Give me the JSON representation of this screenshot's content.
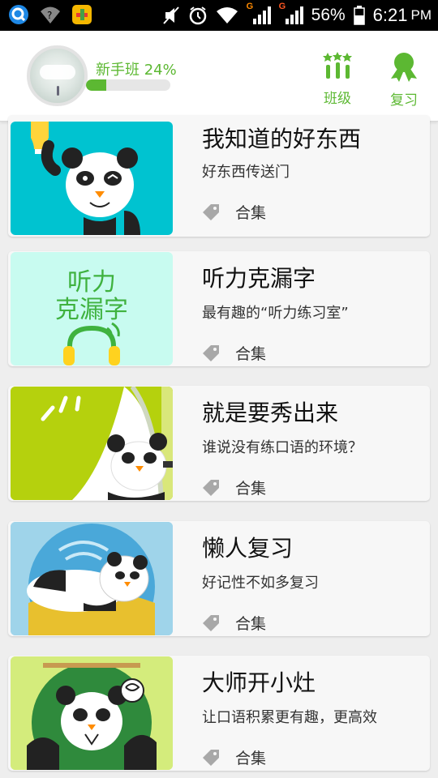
{
  "status_bar": {
    "battery": "56%",
    "time": "6:21",
    "ampm": "PM",
    "net1": "G",
    "net2": "G"
  },
  "header": {
    "level_label": "新手班 24%",
    "progress": 0.24,
    "class_button": "班级",
    "review_button": "复习"
  },
  "colors": {
    "accent": "#5cb832"
  },
  "cards": [
    {
      "title": "我知道的好东西",
      "subtitle": "好东西传送门",
      "tag": "合集"
    },
    {
      "title": "听力克漏字",
      "subtitle": "最有趣的“听力练习室”",
      "tag": "合集",
      "thumb_text_line1": "听力",
      "thumb_text_line2": "克漏字"
    },
    {
      "title": "就是要秀出来",
      "subtitle": "谁说没有练口语的环境？",
      "tag": "合集"
    },
    {
      "title": "懒人复习",
      "subtitle": "好记性不如多复习",
      "tag": "合集"
    },
    {
      "title": "大师开小灶",
      "subtitle": "让口语积累更有趣，更高效",
      "tag": "合集"
    }
  ]
}
